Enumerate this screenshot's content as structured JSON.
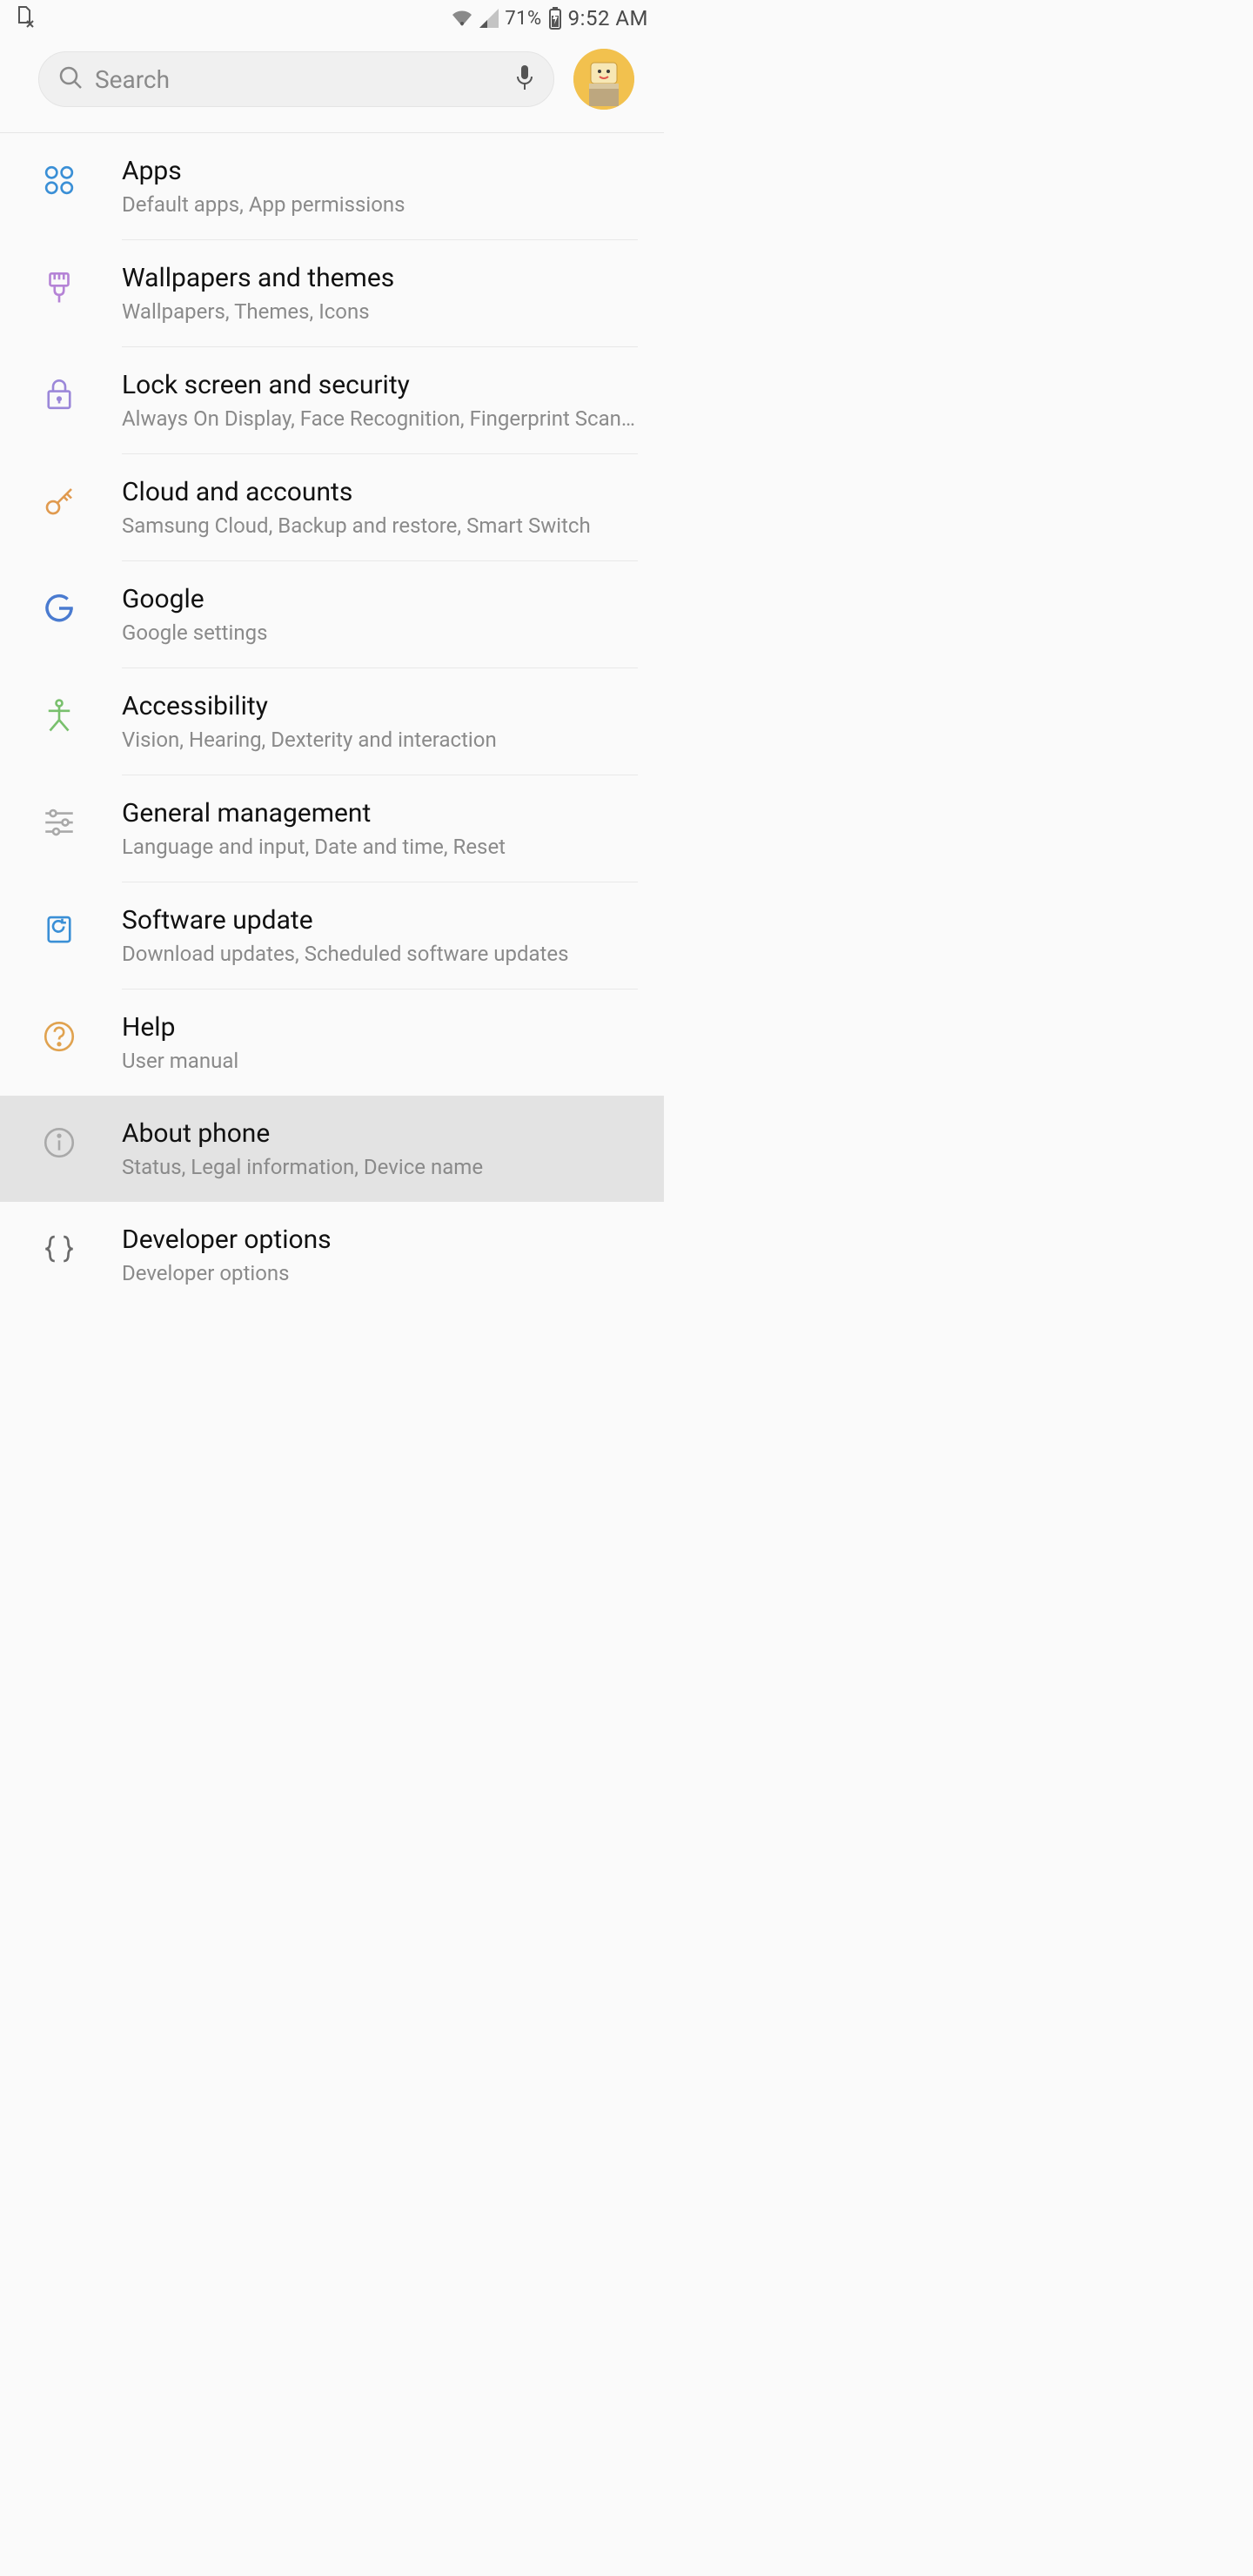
{
  "statusbar": {
    "battery_pct": "71%",
    "time": "9:52 AM"
  },
  "header": {
    "search_placeholder": "Search"
  },
  "settings": [
    {
      "id": "apps",
      "title": "Apps",
      "subtitle": "Default apps, App permissions",
      "icon": "apps",
      "selected": false
    },
    {
      "id": "wallpapers",
      "title": "Wallpapers and themes",
      "subtitle": "Wallpapers, Themes, Icons",
      "icon": "brush",
      "selected": false
    },
    {
      "id": "lock",
      "title": "Lock screen and security",
      "subtitle": "Always On Display, Face Recognition, Fingerprint Scanner",
      "icon": "lock",
      "selected": false
    },
    {
      "id": "cloud",
      "title": "Cloud and accounts",
      "subtitle": "Samsung Cloud, Backup and restore, Smart Switch",
      "icon": "key",
      "selected": false
    },
    {
      "id": "google",
      "title": "Google",
      "subtitle": "Google settings",
      "icon": "google",
      "selected": false
    },
    {
      "id": "a11y",
      "title": "Accessibility",
      "subtitle": "Vision, Hearing, Dexterity and interaction",
      "icon": "person",
      "selected": false
    },
    {
      "id": "general",
      "title": "General management",
      "subtitle": "Language and input, Date and time, Reset",
      "icon": "sliders",
      "selected": false
    },
    {
      "id": "swupdate",
      "title": "Software update",
      "subtitle": "Download updates, Scheduled software updates",
      "icon": "update",
      "selected": false
    },
    {
      "id": "help",
      "title": "Help",
      "subtitle": "User manual",
      "icon": "help",
      "selected": false
    },
    {
      "id": "about",
      "title": "About phone",
      "subtitle": "Status, Legal information, Device name",
      "icon": "info",
      "selected": true
    },
    {
      "id": "devopts",
      "title": "Developer options",
      "subtitle": "Developer options",
      "icon": "braces",
      "selected": false
    }
  ]
}
